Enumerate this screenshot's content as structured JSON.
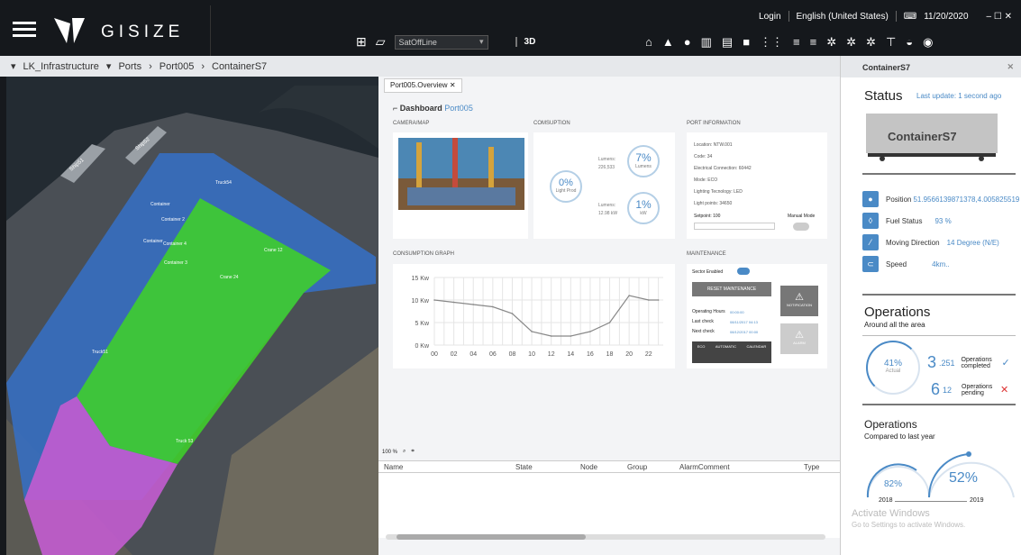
{
  "app": {
    "brand": "GISIZE"
  },
  "topbar": {
    "login": "Login",
    "language": "English (United States)",
    "date": "11/20/2020",
    "window_controls": "– ☐ ✕"
  },
  "toolbar": {
    "select_value": "SatOffLine",
    "btn_3d": "3D"
  },
  "breadcrumb": [
    "LK_Infrastructure",
    "Ports",
    "Port005",
    "ContainerS7"
  ],
  "map": {
    "labels": [
      "Ship51",
      "Ship52",
      "Truck54",
      "Container",
      "Container 2",
      "Container",
      "Container 3",
      "Container 4",
      "Crane 12",
      "Crane 24",
      "Truck51",
      "Truck 53"
    ]
  },
  "dashboard": {
    "tab": "Port005.Overview",
    "title": "Dashboard",
    "title_link": "Port005",
    "camera_header": "Camera/Map",
    "consumption": {
      "header": "Comsuption",
      "total_pct": "0%",
      "total_label": "Light Prod",
      "lumens_pct": "7%",
      "lumens_label": "Lumens",
      "lumens_text": "Lumens:",
      "lumens_val": "226,533",
      "kw_pct": "1%",
      "kw_label": "kW",
      "kw_text": "Lumens:",
      "kw_val": "12.98 kW"
    },
    "port_info": {
      "header": "Port Information",
      "rows": [
        "Location: NTW.001",
        "Code: 34",
        "Electrical Connection: 60442",
        "Mode: ECO",
        "Lighting Tecnology: LED",
        "Light points: 34650"
      ],
      "setpoint": "Setpoint: 100",
      "manual_mode": "Manual Mode"
    },
    "graph": {
      "header": "Consumption Graph"
    },
    "maintenance": {
      "header": "Maintenance",
      "sector": "Sector Enabled",
      "reset": "RESET MAINTENANCE",
      "notification": "NOTIFICATION",
      "alarm": "ALARM",
      "op_hours": "Operating Hours",
      "op_hours_val": "00:00:00",
      "last_check": "Last check",
      "last_check_val": "08/11/2017 04:13",
      "next_check": "Next check",
      "next_check_val": "08/12/2017 00:00",
      "eco": "ECO",
      "automatic": "AUTOMATIC",
      "calendar": "CALENDAR"
    }
  },
  "alarm_table": {
    "zoom": "100 %",
    "columns": [
      "Name",
      "State",
      "Node",
      "Group",
      "AlarmComment",
      "Type"
    ]
  },
  "right_panel": {
    "title": "ContainerS7",
    "status": "Status",
    "last_update": "Last update: 1 second ago",
    "truck_label": "ContainerS7",
    "position_label": "Position",
    "position_val": "51.9566139871378,4.005825519",
    "fuel_label": "Fuel Status",
    "fuel_val": "93 %",
    "dir_label": "Moving Direction",
    "dir_val": "14 Degree (N/E)",
    "speed_label": "Speed",
    "speed_val": "4km..",
    "ops_title": "Operations",
    "ops_sub": "Around all the area",
    "ops_actual_pct": "41%",
    "ops_actual_label": "Actual",
    "ops_completed_num": "3",
    "ops_completed_small": ".251",
    "ops_completed_label": "Operations completed",
    "ops_pending_num": "6",
    "ops_pending_small": "12",
    "ops_pending_label": "Operations pending",
    "ops2_title": "Operations",
    "ops2_sub": "Compared to last year",
    "y2018_pct": "82%",
    "y2019_pct": "52%",
    "y2018": "2018",
    "y2019": "2019",
    "watermark1": "Activate Windows",
    "watermark2": "Go to Settings to activate Windows."
  },
  "chart_data": {
    "type": "line",
    "x": [
      0,
      2,
      4,
      6,
      8,
      10,
      12,
      14,
      16,
      18,
      20,
      22,
      23
    ],
    "xticks": [
      "00",
      "02",
      "04",
      "06",
      "08",
      "10",
      "12",
      "14",
      "16",
      "18",
      "20",
      "22"
    ],
    "yticks": [
      "15 Kw",
      "10 Kw",
      "5 Kw",
      "0 Kw"
    ],
    "ylim": [
      0,
      15
    ],
    "xlim": [
      0,
      23.5
    ],
    "values": [
      10,
      9.5,
      9,
      8.5,
      7,
      3,
      2,
      2,
      3,
      5,
      11,
      10,
      10
    ]
  }
}
